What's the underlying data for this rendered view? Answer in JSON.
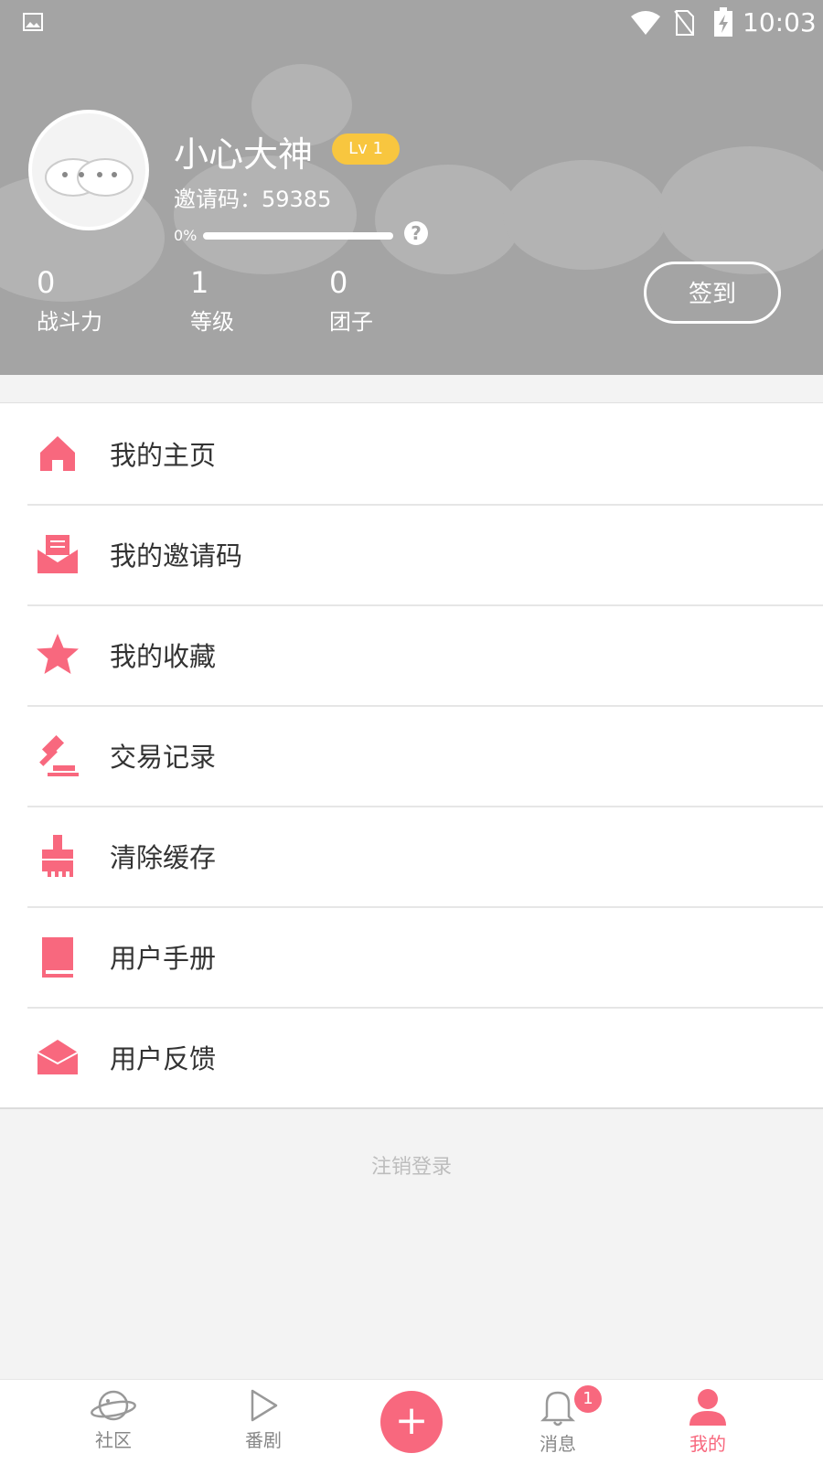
{
  "status_bar": {
    "time": "10:03"
  },
  "profile": {
    "username": "小心大神",
    "level_badge": "Lv 1",
    "invite_code": "邀请码：59385",
    "progress_label": "0%",
    "progress_value": 0,
    "stats": [
      {
        "value": "0",
        "label": "战斗力"
      },
      {
        "value": "1",
        "label": "等级"
      },
      {
        "value": "0",
        "label": "团子"
      }
    ],
    "signin_label": "签到"
  },
  "menu": {
    "items": [
      {
        "label": "我的主页",
        "icon": "home-icon"
      },
      {
        "label": "我的邀请码",
        "icon": "mail-icon"
      },
      {
        "label": "我的收藏",
        "icon": "star-icon"
      },
      {
        "label": "交易记录",
        "icon": "gavel-icon"
      },
      {
        "label": "清除缓存",
        "icon": "brush-icon"
      },
      {
        "label": "用户手册",
        "icon": "book-icon"
      },
      {
        "label": "用户反馈",
        "icon": "envelope-open-icon"
      }
    ]
  },
  "logout_label": "注销登录",
  "bottom_nav": {
    "items": [
      {
        "label": "社区",
        "icon": "planet-icon"
      },
      {
        "label": "番剧",
        "icon": "play-icon"
      },
      {
        "label": "",
        "icon": "plus-icon"
      },
      {
        "label": "消息",
        "icon": "bell-icon",
        "badge": "1"
      },
      {
        "label": "我的",
        "icon": "user-icon",
        "active": true
      }
    ]
  },
  "colors": {
    "accent": "#f8687e",
    "header_bg": "#a4a4a4",
    "level_badge": "#f8c63f"
  }
}
